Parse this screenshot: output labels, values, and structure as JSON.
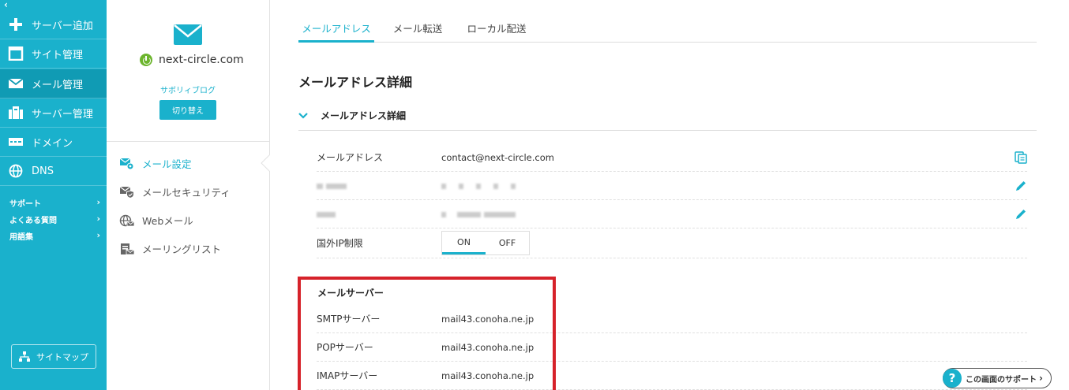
{
  "nav": {
    "collapse_glyph": "‹",
    "items": [
      {
        "label": "サーバー追加",
        "icon": "plus-icon"
      },
      {
        "label": "サイト管理",
        "icon": "window-icon"
      },
      {
        "label": "メール管理",
        "icon": "envelope-icon",
        "active": true
      },
      {
        "label": "サーバー管理",
        "icon": "server-icon"
      },
      {
        "label": "ドメイン",
        "icon": "domain-icon"
      },
      {
        "label": "DNS",
        "icon": "globe-icon"
      }
    ],
    "sub_items": [
      {
        "label": "サポート"
      },
      {
        "label": "よくある質問"
      },
      {
        "label": "用語集"
      }
    ],
    "chevron": "›",
    "sitemap_label": "サイトマップ",
    "colors": {
      "bg": "#1ab1cc",
      "active": "#109bb4"
    }
  },
  "account": {
    "domain": "next-circle.com",
    "status_color": "#6cb52d",
    "blog_name": "サボリィブログ",
    "switch_label": "切り替え"
  },
  "side_menu": [
    {
      "label": "メール設定",
      "icon": "mail-gear-icon",
      "active": true
    },
    {
      "label": "メールセキュリティ",
      "icon": "mail-shield-icon"
    },
    {
      "label": "Webメール",
      "icon": "webmail-icon"
    },
    {
      "label": "メーリングリスト",
      "icon": "mailing-list-icon"
    }
  ],
  "tabs": [
    {
      "label": "メールアドレス",
      "active": true
    },
    {
      "label": "メール転送"
    },
    {
      "label": "ローカル配送"
    }
  ],
  "page_title": "メールアドレス詳細",
  "section_title": "メールアドレス詳細",
  "details": {
    "email_label": "メールアドレス",
    "email_value": "contact@next-circle.com",
    "ip_label": "国外IP制限",
    "ip_on": "ON",
    "ip_off": "OFF"
  },
  "mail_server": {
    "title": "メールサーバー",
    "rows": [
      {
        "label": "SMTPサーバー",
        "value": "mail43.conoha.ne.jp"
      },
      {
        "label": "POPサーバー",
        "value": "mail43.conoha.ne.jp"
      },
      {
        "label": "IMAPサーバー",
        "value": "mail43.conoha.ne.jp"
      }
    ]
  },
  "support_label": "この画面のサポート",
  "support_chevron": "›",
  "accent": "#1ab1cc",
  "highlight_color": "#d6222a"
}
